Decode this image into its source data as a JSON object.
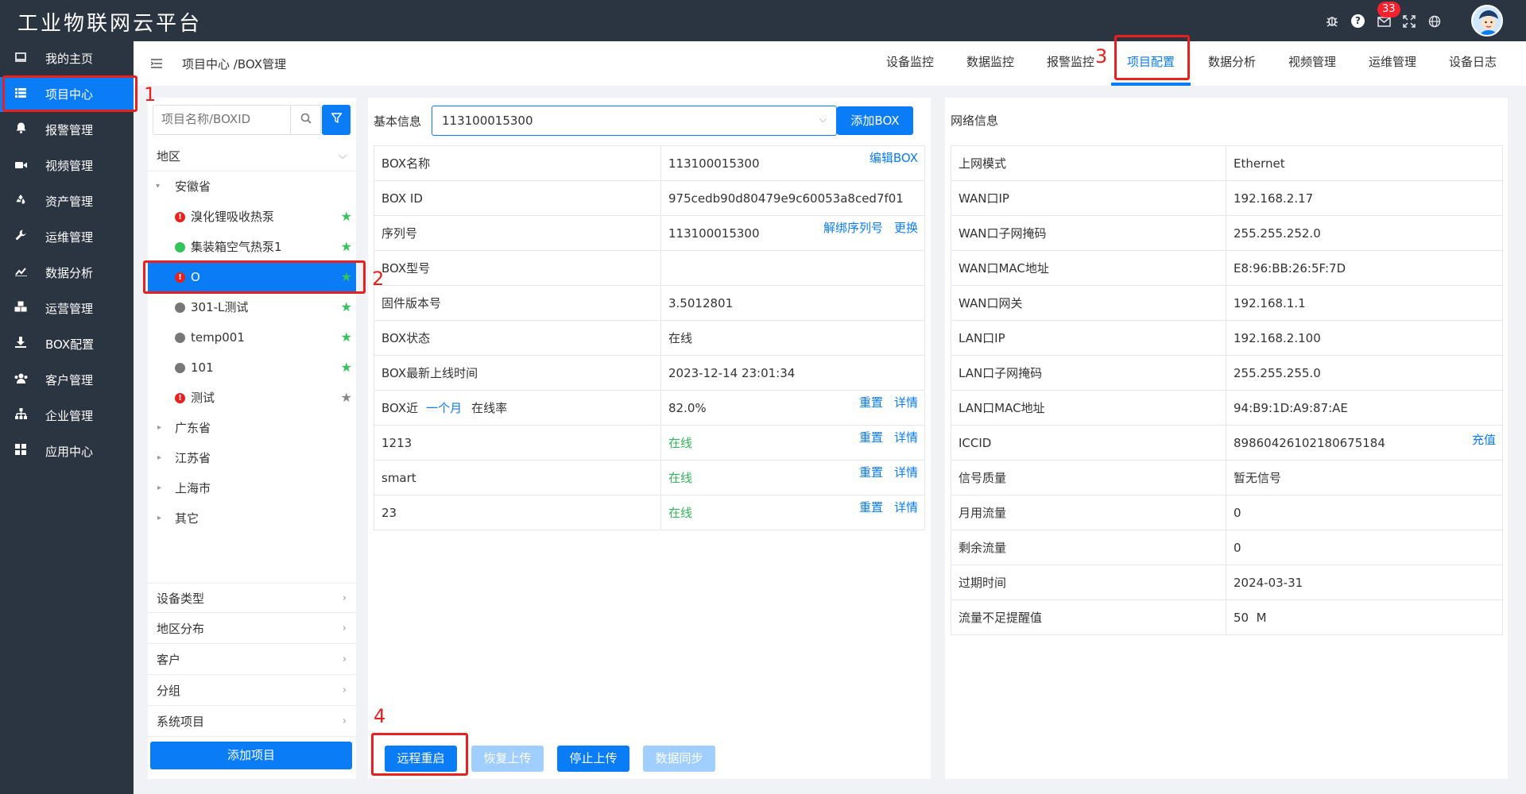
{
  "app": {
    "title": "工业物联网云平台",
    "notification_count": "33"
  },
  "topbar_icons": [
    "bug-icon",
    "help-icon",
    "mail-icon",
    "fullscreen-icon",
    "globe-icon"
  ],
  "sidebar": {
    "items": [
      {
        "label": "我的主页",
        "icon": "monitor-icon"
      },
      {
        "label": "项目中心",
        "icon": "grid-list-icon",
        "active": true
      },
      {
        "label": "报警管理",
        "icon": "bell-icon"
      },
      {
        "label": "视频管理",
        "icon": "video-icon"
      },
      {
        "label": "资产管理",
        "icon": "recycle-icon"
      },
      {
        "label": "运维管理",
        "icon": "wrench-icon"
      },
      {
        "label": "数据分析",
        "icon": "chart-icon"
      },
      {
        "label": "运营管理",
        "icon": "cubes-icon"
      },
      {
        "label": "BOX配置",
        "icon": "download-icon"
      },
      {
        "label": "客户管理",
        "icon": "users-icon"
      },
      {
        "label": "企业管理",
        "icon": "org-icon"
      },
      {
        "label": "应用中心",
        "icon": "apps-icon"
      }
    ]
  },
  "header": {
    "breadcrumb": "项目中心 /BOX管理",
    "tabs": [
      "设备监控",
      "数据监控",
      "报警监控",
      "项目配置",
      "数据分析",
      "视频管理",
      "运维管理",
      "设备日志"
    ],
    "active_tab": "项目配置"
  },
  "left_panel": {
    "search_placeholder": "项目名称/BOXID",
    "region_label": "地区",
    "tree": {
      "province": "安徽省",
      "projects": [
        {
          "name": "溴化锂吸收热泵",
          "status": "warn",
          "starred": true
        },
        {
          "name": "集装箱空气热泵1",
          "status": "green",
          "starred": true
        },
        {
          "name": "O",
          "status": "warn",
          "starred": true,
          "selected": true
        },
        {
          "name": "301-L测试",
          "status": "gray",
          "starred": true
        },
        {
          "name": "temp001",
          "status": "gray",
          "starred": true
        },
        {
          "name": "101",
          "status": "gray",
          "starred": true
        },
        {
          "name": "测试",
          "status": "warn",
          "starred": false
        }
      ],
      "other_regions": [
        "广东省",
        "江苏省",
        "上海市",
        "其它"
      ]
    },
    "sections": [
      "设备类型",
      "地区分布",
      "客户",
      "分组",
      "系统项目"
    ],
    "add_project": "添加项目"
  },
  "mid_panel": {
    "basic_info_label": "基本信息",
    "box_select_value": "113100015300",
    "add_box": "添加BOX",
    "box_name_label": "BOX名称",
    "box_name": "113100015300",
    "edit_box": "编辑BOX",
    "box_id_label": "BOX ID",
    "box_id": "975cedb90d80479e9c60053a8ced7f01",
    "serial_label": "序列号",
    "serial": "113100015300",
    "unbind_serial": "解绑序列号",
    "replace": "更换",
    "model_label": "BOX型号",
    "model": "",
    "firmware_label": "固件版本号",
    "firmware": "3.5012801",
    "status_label": "BOX状态",
    "status": "在线",
    "last_online_label": "BOX最新上线时间",
    "last_online": "2023-12-14 23:01:34",
    "online_rate_prefix": "BOX近",
    "online_rate_period": "一个月",
    "online_rate_suffix": "在线率",
    "online_rate": "82.0%",
    "reset": "重置",
    "details": "详情",
    "channels": [
      {
        "name": "1213",
        "status": "在线"
      },
      {
        "name": "smart",
        "status": "在线"
      },
      {
        "name": "23",
        "status": "在线"
      }
    ],
    "buttons": {
      "remote_restart": "远程重启",
      "resume_upload": "恢复上传",
      "stop_upload": "停止上传",
      "data_sync": "数据同步"
    }
  },
  "right_panel": {
    "title": "网络信息",
    "rows": [
      {
        "label": "上网模式",
        "value": "Ethernet"
      },
      {
        "label": "WAN口IP",
        "value": "192.168.2.17"
      },
      {
        "label": "WAN口子网掩码",
        "value": "255.255.252.0"
      },
      {
        "label": "WAN口MAC地址",
        "value": "E8:96:BB:26:5F:7D"
      },
      {
        "label": "WAN口网关",
        "value": "192.168.1.1"
      },
      {
        "label": "LAN口IP",
        "value": "192.168.2.100"
      },
      {
        "label": "LAN口子网掩码",
        "value": "255.255.255.0"
      },
      {
        "label": "LAN口MAC地址",
        "value": "94:B9:1D:A9:87:AE"
      },
      {
        "label": "ICCID",
        "value": "89860426102180675184",
        "action": "充值"
      },
      {
        "label": "信号质量",
        "value": "暂无信号"
      },
      {
        "label": "月用流量",
        "value": "0"
      },
      {
        "label": "剩余流量",
        "value": "0"
      },
      {
        "label": "过期时间",
        "value": "2024-03-31"
      },
      {
        "label": "流量不足提醒值",
        "value": "50  M",
        "highlight": true
      }
    ]
  },
  "annotations": [
    "1",
    "2",
    "3",
    "4"
  ],
  "colors": {
    "accent": "#0a7cf5",
    "sidebar_bg": "#2b3441",
    "online": "#33b35a",
    "alert": "#e8201e"
  }
}
